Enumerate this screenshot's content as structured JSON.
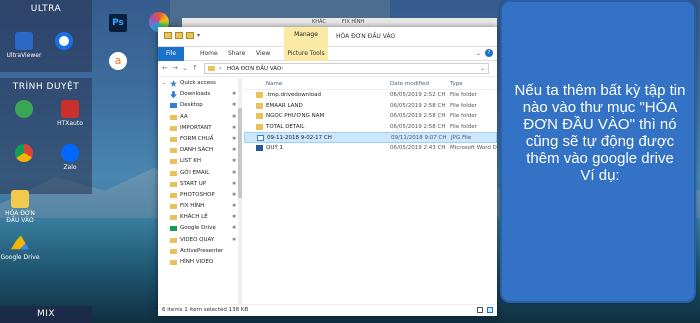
{
  "desktop": {
    "panels": {
      "ultra_title": "ULTRA",
      "trinh_duyet_title": "TRÌNH DUYỆT",
      "mix_title": "MIX"
    },
    "icons": {
      "ultraviewer": "UltraViewer",
      "teamviewer": "",
      "htxauto": "HTXauto",
      "zalo": "Zalo",
      "hoa_don": "HÓA ĐƠN ĐẦU VÀO",
      "google_drive": "Google Drive"
    },
    "bg_window_labels": [
      "KHÁC",
      "FIX HÌNH"
    ]
  },
  "explorer": {
    "title": "HÓA ĐƠN ĐẦU VÀO",
    "manage_label": "Manage",
    "tabs": {
      "file": "File",
      "home": "Home",
      "share": "Share",
      "view": "View",
      "picture_tools": "Picture Tools"
    },
    "address": {
      "path": "HÓA ĐƠN ĐẦU VÀO"
    },
    "nav_items": [
      {
        "label": "Quick access",
        "icon": "star-icon",
        "pinned": false
      },
      {
        "label": "Downloads",
        "icon": "download-icon",
        "pinned": true
      },
      {
        "label": "Desktop",
        "icon": "desktop-icon",
        "pinned": true
      },
      {
        "label": "AA",
        "icon": "folder-icon",
        "pinned": true
      },
      {
        "label": "IMPORTANT",
        "icon": "folder-icon",
        "pinned": true
      },
      {
        "label": "FORM CHUẨ",
        "icon": "folder-icon",
        "pinned": true
      },
      {
        "label": "DANH SÁCH",
        "icon": "folder-icon",
        "pinned": true
      },
      {
        "label": "LIST KH",
        "icon": "folder-icon",
        "pinned": true
      },
      {
        "label": "GỞI EMAIL",
        "icon": "folder-icon",
        "pinned": true
      },
      {
        "label": "START UP",
        "icon": "folder-icon",
        "pinned": true
      },
      {
        "label": "PHOTOSHOP",
        "icon": "folder-icon",
        "pinned": true
      },
      {
        "label": "FIX HÌNH",
        "icon": "folder-icon",
        "pinned": true
      },
      {
        "label": "KHÁCH LẺ",
        "icon": "folder-icon",
        "pinned": true
      },
      {
        "label": "Google Drive",
        "icon": "google-drive-icon",
        "pinned": true
      },
      {
        "label": "VIDEO QUAY",
        "icon": "folder-icon",
        "pinned": true
      },
      {
        "label": "ActivePresenter",
        "icon": "folder-icon",
        "pinned": false
      },
      {
        "label": "HÌNH VIDEO",
        "icon": "folder-icon",
        "pinned": false
      }
    ],
    "columns": {
      "name": "Name",
      "date": "Date modified",
      "type": "Type"
    },
    "files": [
      {
        "name": ".tmp.drivedownload",
        "date": "06/05/2019 2:52 CH",
        "type": "File folder",
        "icon": "folder-icon",
        "selected": false
      },
      {
        "name": "EMAAR LAND",
        "date": "06/05/2019 2:58 CH",
        "type": "File folder",
        "icon": "folder-icon",
        "selected": false
      },
      {
        "name": "NGỌC PHƯƠNG NAM",
        "date": "06/05/2019 2:58 CH",
        "type": "File folder",
        "icon": "folder-icon",
        "selected": false
      },
      {
        "name": "TOTAL DETAIL",
        "date": "06/05/2019 2:58 CH",
        "type": "File folder",
        "icon": "folder-icon",
        "selected": false
      },
      {
        "name": "09-11-2018 9-02-17 CH",
        "date": "09/11/2018 9:07 CH",
        "type": "JPG File",
        "icon": "image-file-icon",
        "selected": true
      },
      {
        "name": "QUÝ 1",
        "date": "06/05/2019 2:43 CH",
        "type": "Microsoft Word D",
        "icon": "word-file-icon",
        "selected": false
      }
    ],
    "status": "6 items    1 item selected  138 KB"
  },
  "callout": {
    "text": "Nếu ta thêm bất kỳ tập tin nào vào thư mục \"HÓA ĐƠN ĐẦU VÀO\" thì nó cũng sẽ tự động được thêm vào google drive\nVí dụ:"
  }
}
